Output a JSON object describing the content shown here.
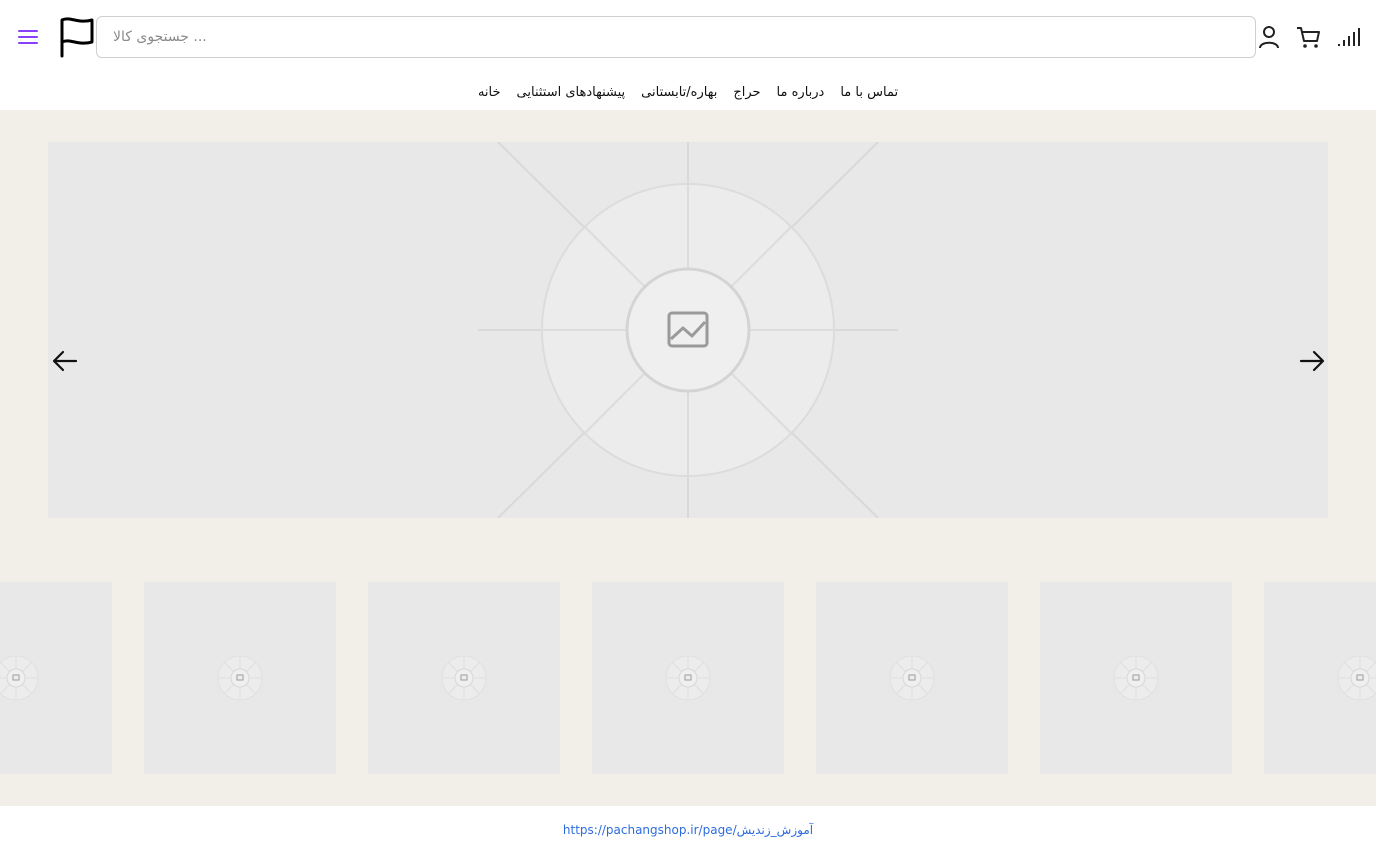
{
  "header": {
    "search_placeholder": "... جستجوی کالا",
    "icons": [
      "menu-icon",
      "flag-logo-icon",
      "user-icon",
      "cart-icon",
      "signal-icon"
    ],
    "accent_color": "#8a3ffc"
  },
  "nav": {
    "items": [
      {
        "label": "تماس با ما"
      },
      {
        "label": "درباره ما"
      },
      {
        "label": "حراج"
      },
      {
        "label": "بهاره/تابستانی"
      },
      {
        "label": "پیشنهادهای استثنایی"
      },
      {
        "label": "خانه"
      }
    ]
  },
  "hero": {
    "image": "image-placeholder-icon",
    "prev_icon": "arrow-left-icon",
    "next_icon": "arrow-right-icon"
  },
  "thumbnails": {
    "count": 7,
    "image": "image-placeholder-icon"
  },
  "footer": {
    "link": "https://pachangshop.ir/page/آموزش_زندیش"
  },
  "colors": {
    "background": "#f2efe9",
    "placeholder": "#e8e8e8",
    "link": "#2d6cdf"
  }
}
